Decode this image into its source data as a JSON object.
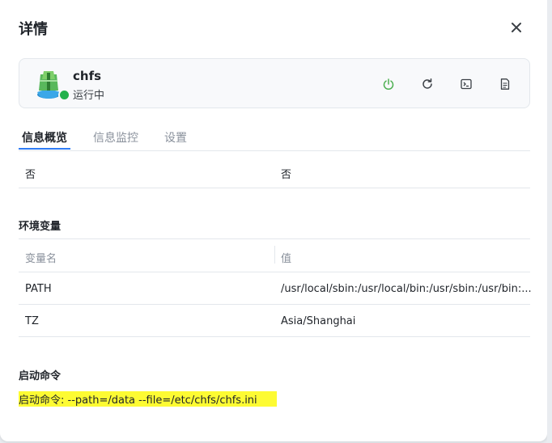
{
  "dialog": {
    "title": "详情",
    "close_icon": "close-icon"
  },
  "app": {
    "name": "chfs",
    "status": "运行中",
    "status_color": "#22b14c",
    "actions": [
      "power-icon",
      "restart-icon",
      "terminal-icon",
      "log-icon"
    ]
  },
  "tabs": [
    {
      "label": "信息概览",
      "active": true
    },
    {
      "label": "信息监控",
      "active": false
    },
    {
      "label": "设置",
      "active": false
    }
  ],
  "partial_row": {
    "col1": "否",
    "col2": "否"
  },
  "env": {
    "section_title": "环境变量",
    "headers": [
      "变量名",
      "值"
    ],
    "rows": [
      {
        "name": "PATH",
        "value": "/usr/local/sbin:/usr/local/bin:/usr/sbin:/usr/bin:..."
      },
      {
        "name": "TZ",
        "value": "Asia/Shanghai"
      }
    ]
  },
  "startup": {
    "section_title": "启动命令",
    "command": "启动命令: --path=/data --file=/etc/chfs/chfs.ini",
    "highlight_color": "#fdfb33"
  },
  "accent_color": "#2f7cf6"
}
